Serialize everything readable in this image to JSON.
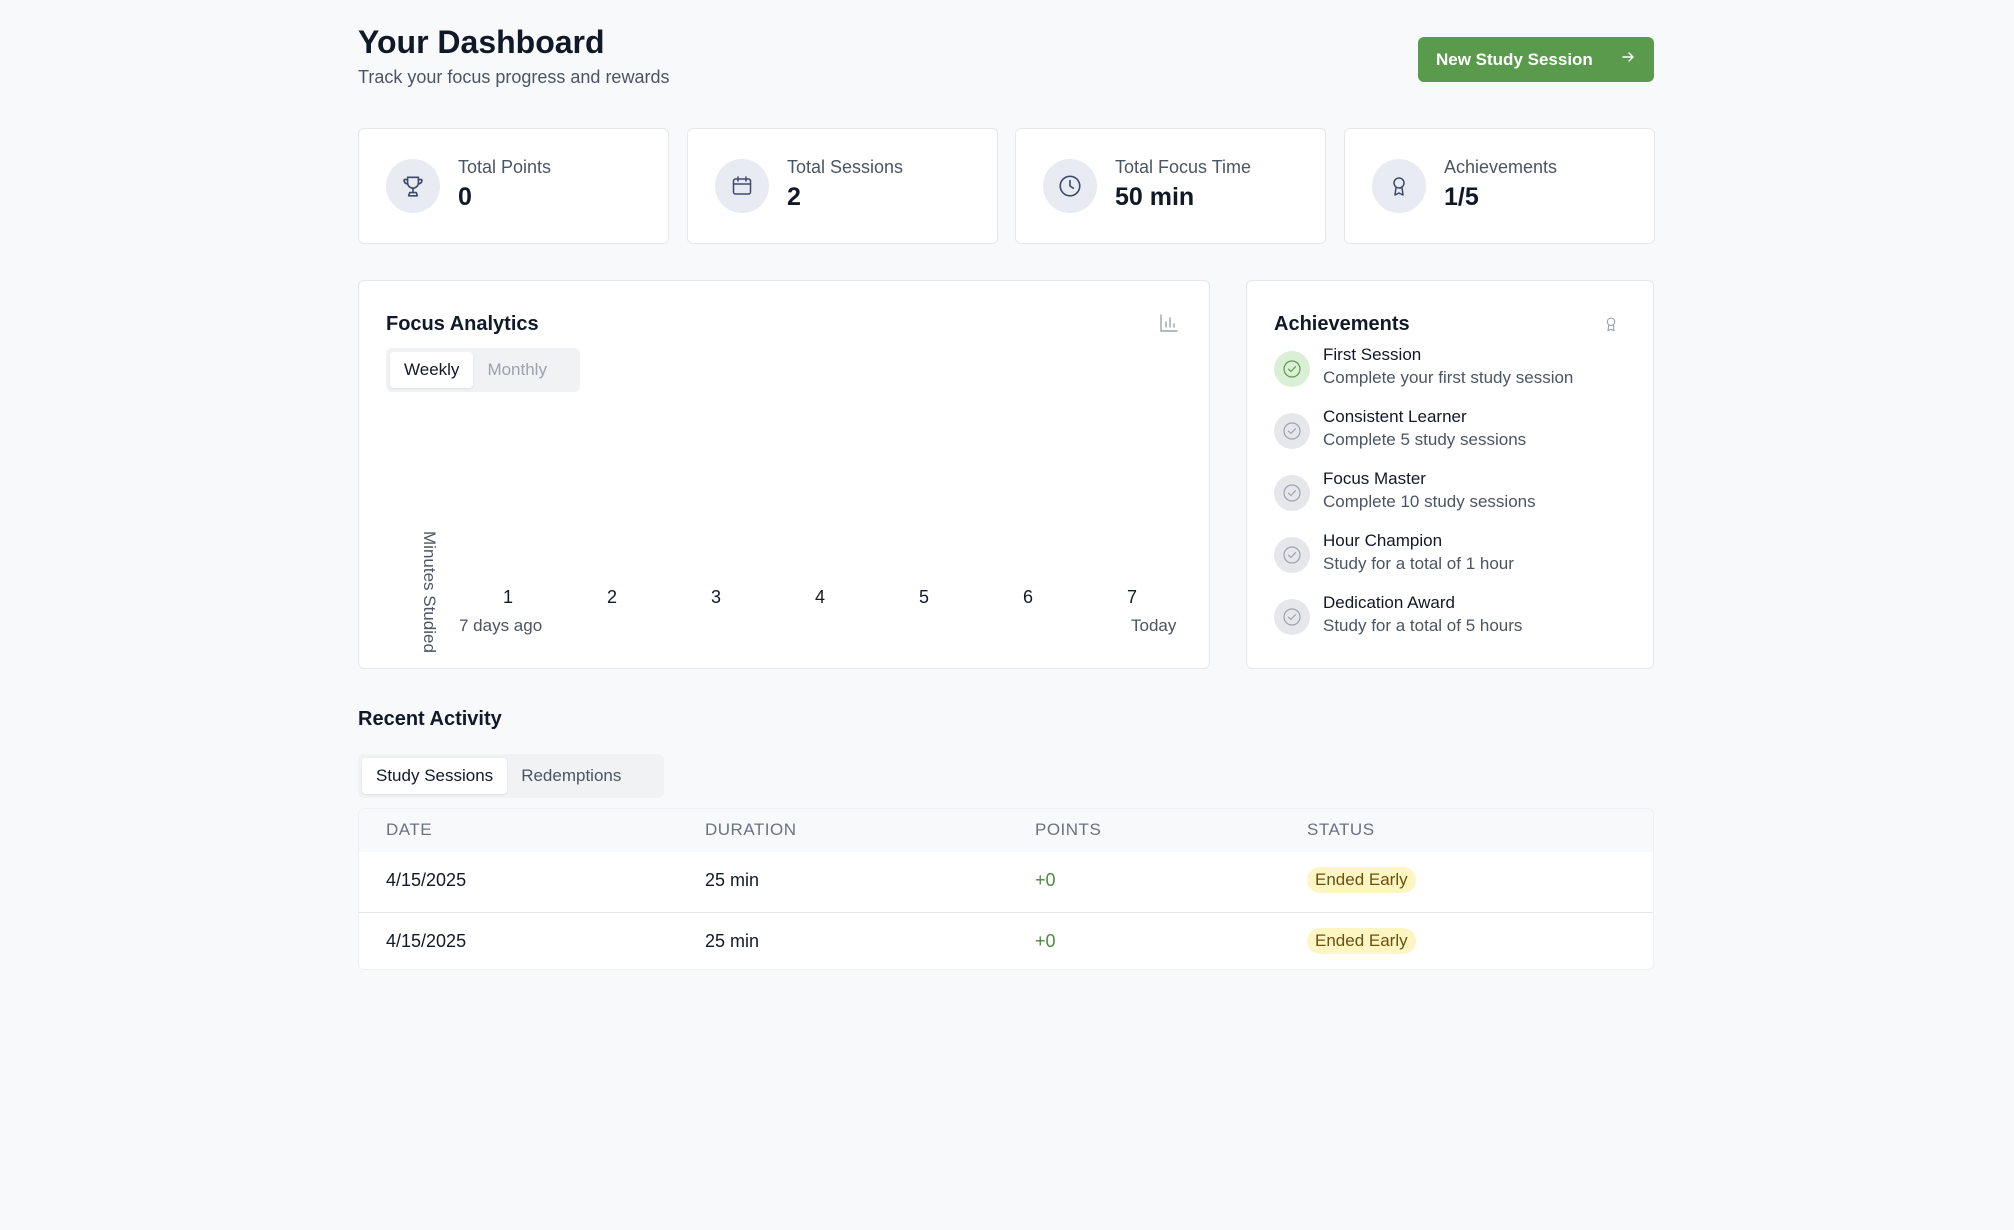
{
  "header": {
    "title": "Your Dashboard",
    "subtitle": "Track your focus progress and rewards",
    "new_session_label": "New Study Session"
  },
  "stats": [
    {
      "label": "Total Points",
      "value": "0",
      "icon": "trophy-icon"
    },
    {
      "label": "Total Sessions",
      "value": "2",
      "icon": "calendar-icon"
    },
    {
      "label": "Total Focus Time",
      "value": "50 min",
      "icon": "clock-icon"
    },
    {
      "label": "Achievements",
      "value": "1/5",
      "icon": "award-icon"
    }
  ],
  "analytics": {
    "title": "Focus Analytics",
    "tabs": [
      {
        "label": "Weekly",
        "active": true
      },
      {
        "label": "Monthly",
        "active": false
      }
    ],
    "y_axis_label": "Minutes Studied",
    "x_start_label": "7 days ago",
    "x_end_label": "Today"
  },
  "chart_data": {
    "type": "bar",
    "categories": [
      "1",
      "2",
      "3",
      "4",
      "5",
      "6",
      "7"
    ],
    "values": [],
    "title": "",
    "xlabel": "",
    "ylabel": "Minutes Studied",
    "grid": false
  },
  "achievements": {
    "title": "Achievements",
    "items": [
      {
        "name": "First Session",
        "description": "Complete your first study session",
        "unlocked": true
      },
      {
        "name": "Consistent Learner",
        "description": "Complete 5 study sessions",
        "unlocked": false
      },
      {
        "name": "Focus Master",
        "description": "Complete 10 study sessions",
        "unlocked": false
      },
      {
        "name": "Hour Champion",
        "description": "Study for a total of 1 hour",
        "unlocked": false
      },
      {
        "name": "Dedication Award",
        "description": "Study for a total of 5 hours",
        "unlocked": false
      }
    ]
  },
  "recent_activity": {
    "title": "Recent Activity",
    "tabs": [
      {
        "label": "Study Sessions",
        "active": true
      },
      {
        "label": "Redemptions",
        "active": false
      }
    ],
    "columns": [
      "DATE",
      "DURATION",
      "POINTS",
      "STATUS"
    ],
    "rows": [
      {
        "date": "4/15/2025",
        "duration": "25 min",
        "points": "+0",
        "status": "Ended Early"
      },
      {
        "date": "4/15/2025",
        "duration": "25 min",
        "points": "+0",
        "status": "Ended Early"
      }
    ]
  },
  "colors": {
    "accent": "#5a9a4d",
    "status_badge_bg": "#fdf6c3",
    "points_text": "#4c8a3f"
  }
}
